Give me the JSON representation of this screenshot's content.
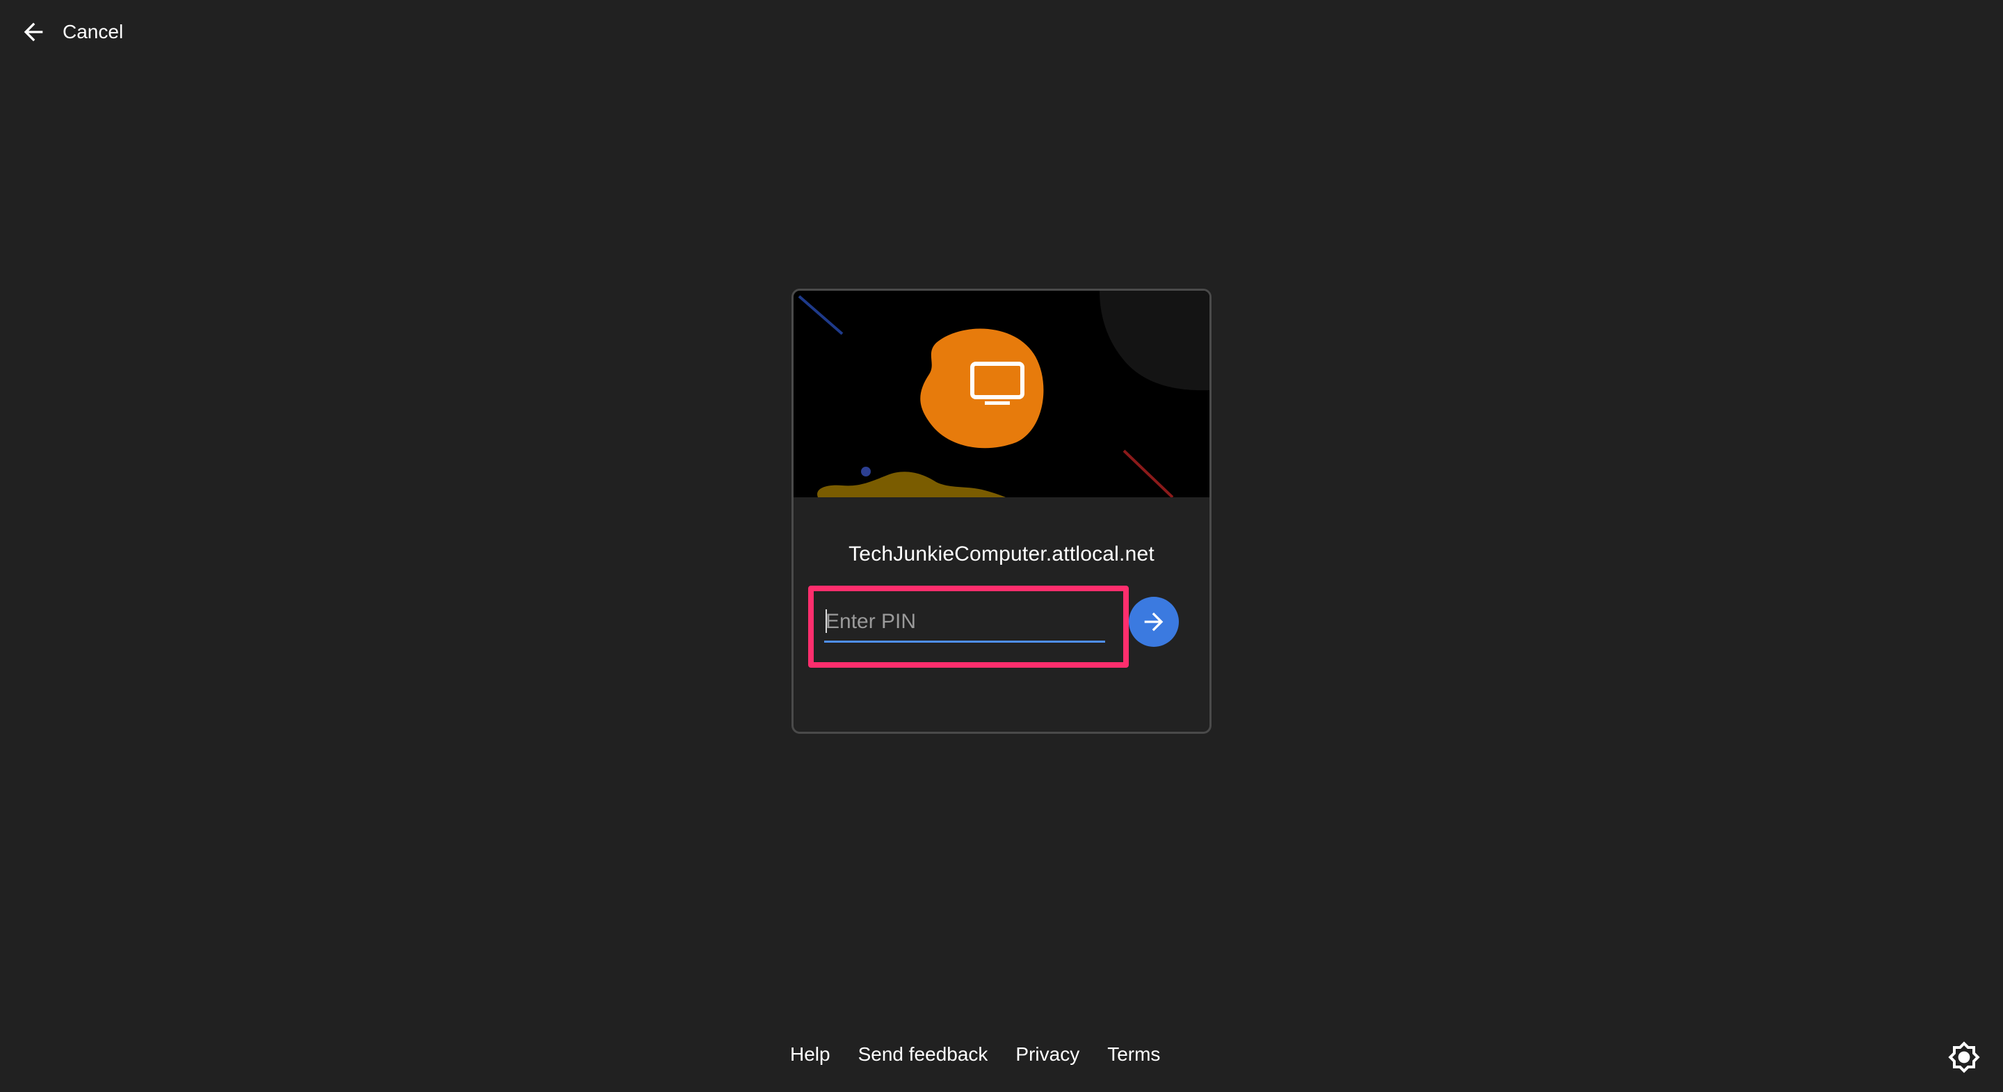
{
  "header": {
    "cancel_label": "Cancel",
    "back_icon": "arrow-left-icon"
  },
  "card": {
    "hero_icon": "monitor-icon",
    "host_name": "TechJunkieComputer.attlocal.net",
    "pin": {
      "value": "",
      "placeholder": "Enter PIN"
    },
    "submit_icon": "arrow-right-icon"
  },
  "footer": {
    "links": [
      "Help",
      "Send feedback",
      "Privacy",
      "Terms"
    ]
  },
  "theme_toggle_icon": "brightness-icon",
  "colors": {
    "background": "#212121",
    "card_border": "#4a4a4a",
    "hero_background": "#000000",
    "blob_orange": "#e77b0c",
    "submit_blue": "#3b7ae0",
    "input_underline": "#4f8ff7",
    "highlight_pink": "#ff2e6d"
  }
}
